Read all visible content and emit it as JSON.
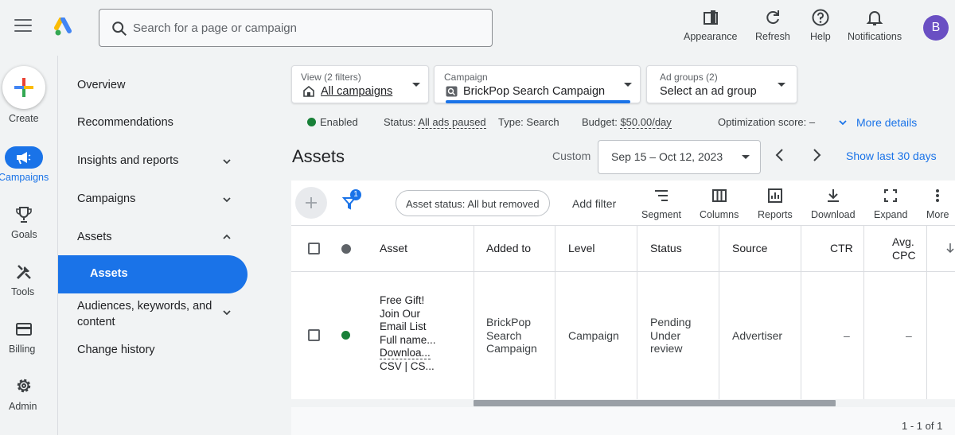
{
  "topbar": {
    "search_placeholder": "Search for a page or campaign",
    "actions": [
      {
        "label": "Appearance",
        "icon": "appearance-icon"
      },
      {
        "label": "Refresh",
        "icon": "refresh-icon"
      },
      {
        "label": "Help",
        "icon": "help-icon"
      },
      {
        "label": "Notifications",
        "icon": "bell-icon"
      }
    ],
    "avatar_initial": "B",
    "avatar_color": "#6a4fc3"
  },
  "rail": {
    "items": [
      {
        "label": "Create",
        "icon": "plus-icon"
      },
      {
        "label": "Campaigns",
        "icon": "megaphone-icon",
        "active": true
      },
      {
        "label": "Goals",
        "icon": "trophy-icon"
      },
      {
        "label": "Tools",
        "icon": "tools-icon"
      },
      {
        "label": "Billing",
        "icon": "credit-card-icon"
      },
      {
        "label": "Admin",
        "icon": "gear-icon"
      }
    ]
  },
  "nav": {
    "items": [
      {
        "label": "Overview"
      },
      {
        "label": "Recommendations"
      },
      {
        "label": "Insights and reports",
        "chevron": "down"
      },
      {
        "label": "Campaigns",
        "chevron": "down"
      },
      {
        "label": "Assets",
        "chevron": "up"
      },
      {
        "label": "Assets",
        "active": true
      },
      {
        "label_line1": "Audiences, keywords, and",
        "label_line2": "content",
        "chevron": "down"
      },
      {
        "label": "Change history"
      }
    ]
  },
  "filters": {
    "view": {
      "small": "View (2 filters)",
      "value": "All campaigns"
    },
    "campaign": {
      "small": "Campaign",
      "value": "BrickPop Search Campaign"
    },
    "ad_groups": {
      "small": "Ad groups (2)",
      "value": "Select an ad group"
    }
  },
  "status_row": {
    "enabled": "Enabled",
    "status_label": "Status:",
    "status_value": "All ads paused",
    "type": "Type: Search",
    "budget_label": "Budget:",
    "budget_value": "$50.00/day",
    "optimization": "Optimization score: –",
    "more_details": "More details",
    "enabled_color": "#188038"
  },
  "assets": {
    "title": "Assets",
    "custom_label": "Custom",
    "date_range": "Sep 15 – Oct 12, 2023",
    "show_last": "Show last 30 days"
  },
  "toolbar": {
    "filter_count": "1",
    "chip": "Asset status: All but removed",
    "add_filter": "Add filter",
    "buttons": [
      {
        "label": "Segment",
        "icon": "segment-icon"
      },
      {
        "label": "Columns",
        "icon": "columns-icon"
      },
      {
        "label": "Reports",
        "icon": "reports-icon"
      },
      {
        "label": "Download",
        "icon": "download-icon"
      },
      {
        "label": "Expand",
        "icon": "expand-icon"
      },
      {
        "label": "More",
        "icon": "more-vert-icon"
      }
    ]
  },
  "table": {
    "columns": [
      "Asset",
      "Added to",
      "Level",
      "Status",
      "Source",
      "CTR",
      "Avg.",
      "CPC"
    ],
    "rows": [
      {
        "asset_lines": [
          "Free Gift!",
          "Join Our",
          "Email List",
          "Full name..."
        ],
        "asset_download": "Downloa...",
        "asset_csv": "CSV | CS...",
        "added_to": [
          "BrickPop",
          "Search",
          "Campaign"
        ],
        "level": "Campaign",
        "status": [
          "Pending",
          "Under",
          "review"
        ],
        "source": "Advertiser",
        "ctr": "–",
        "avg_cpc": "–",
        "status_color": "#188038"
      }
    ],
    "pager": "1 - 1 of 1"
  }
}
